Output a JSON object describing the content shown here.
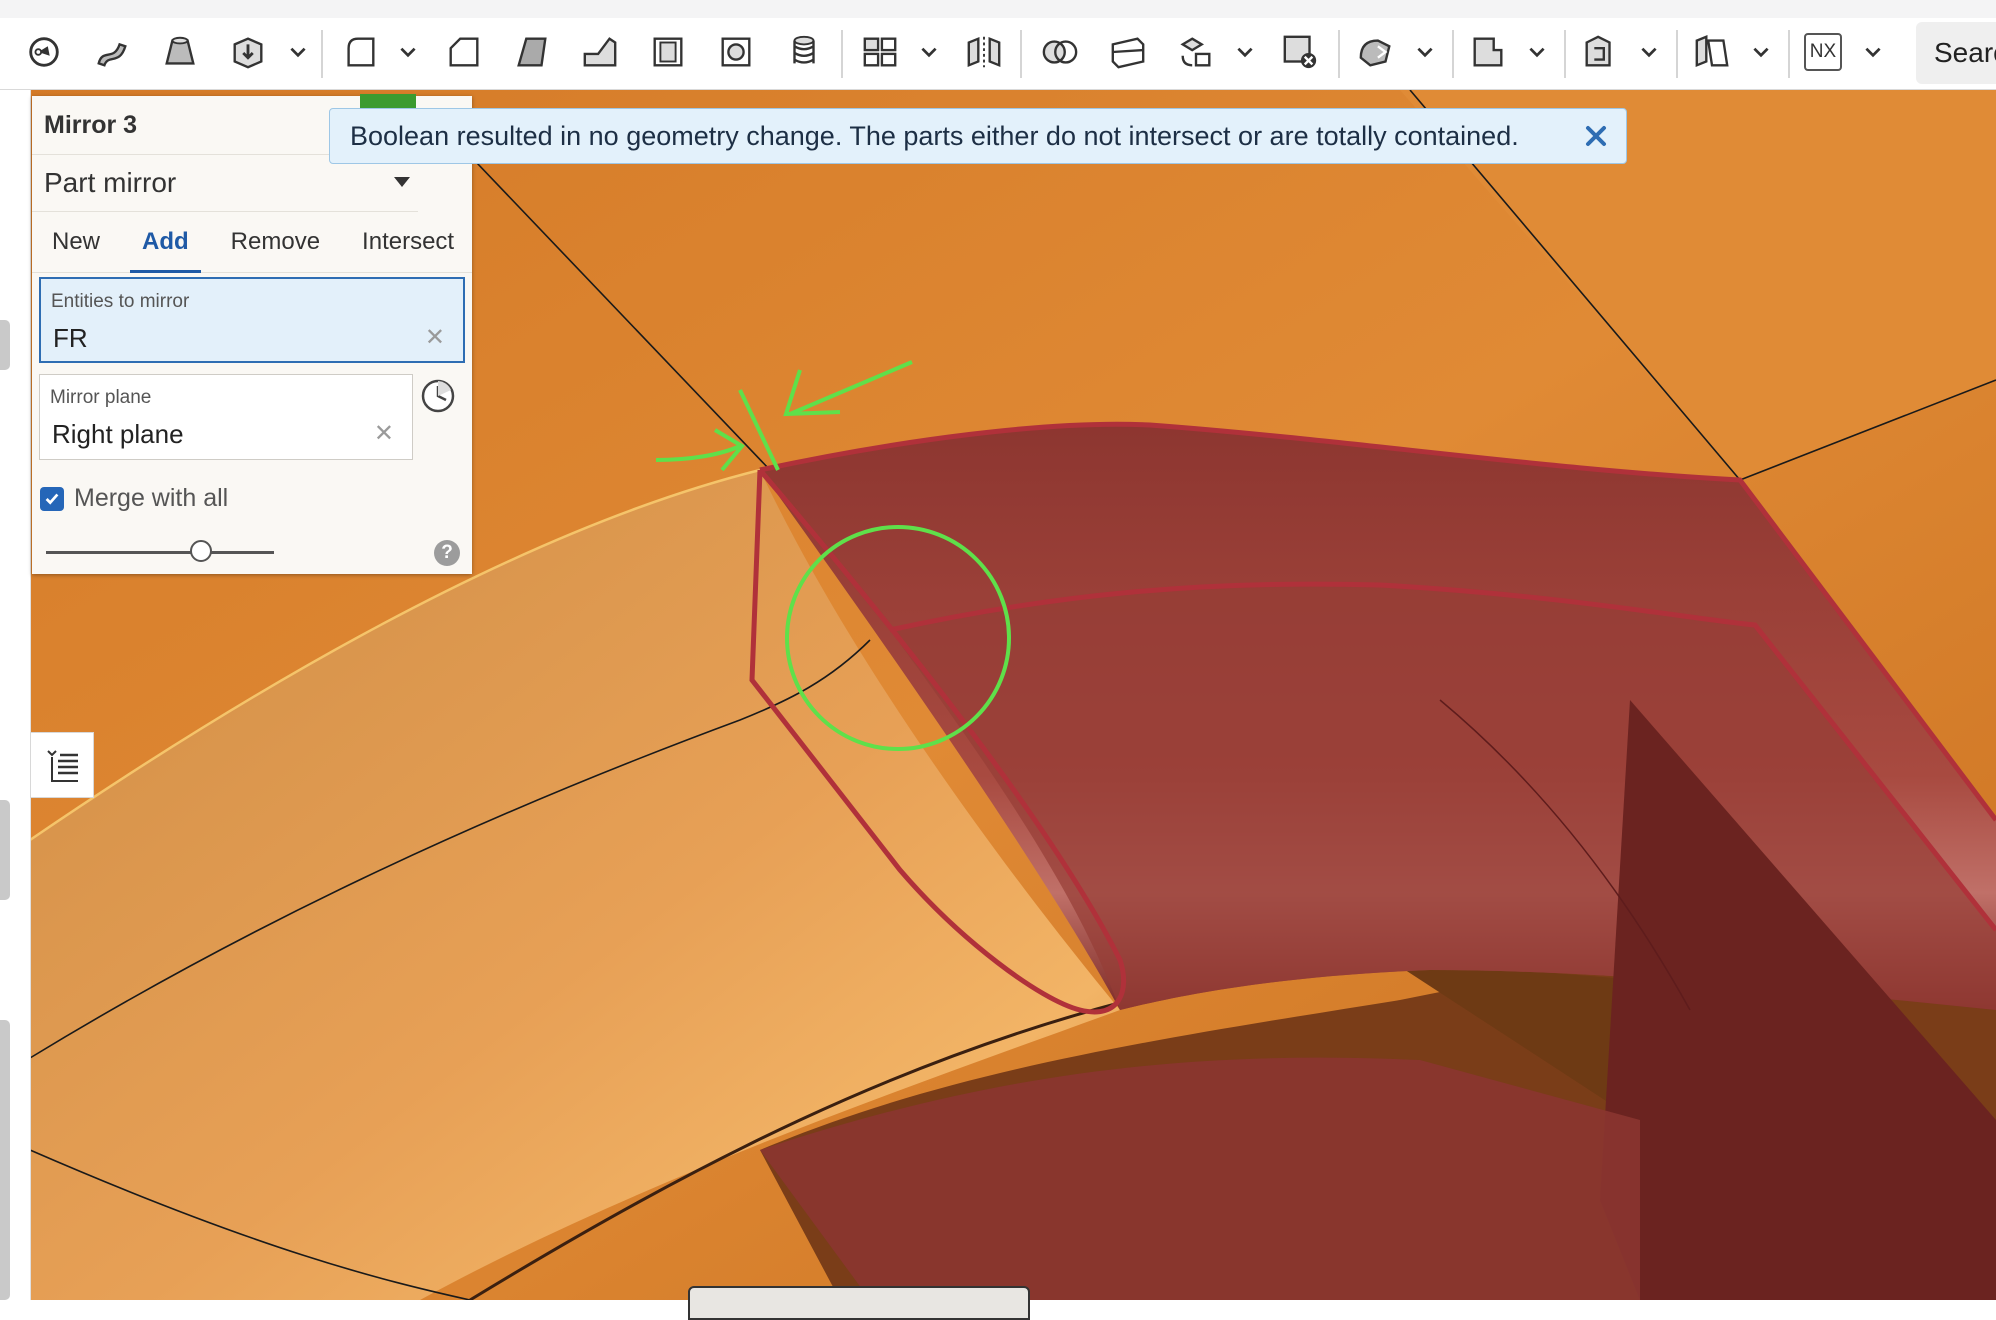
{
  "toolbar": {
    "icons": [
      "sketch-icon",
      "sweep-icon",
      "loft-icon",
      "extrude-menu-icon",
      "fillet-icon",
      "chamfer-icon",
      "draft-icon",
      "rib-icon",
      "shell-icon",
      "hole-icon",
      "thread-icon",
      "pattern-icon",
      "mirror-icon",
      "boolean-icon",
      "split-icon",
      "transform-icon",
      "delete-part-icon",
      "modify-fillet-icon",
      "plane-icon",
      "sheet-metal-icon",
      "flange-icon",
      "nx-icon"
    ],
    "nx_label": "NX",
    "search_label": "Searc"
  },
  "dialog": {
    "title": "Mirror 3",
    "mirror_type": "Part mirror",
    "tabs": [
      "New",
      "Add",
      "Remove",
      "Intersect"
    ],
    "active_tab": "Add",
    "entities_field": {
      "label": "Entities to mirror",
      "value": "FR"
    },
    "plane_field": {
      "label": "Mirror plane",
      "value": "Right plane"
    },
    "merge_label": "Merge with all",
    "merge_checked": true
  },
  "notification": {
    "message": "Boolean resulted in no geometry change. The parts either do not intersect or are totally contained."
  },
  "colors": {
    "accent": "#2566b8",
    "orange_part": "#d8802c",
    "red_part": "#8a3530",
    "annotation": "#5fe04a",
    "notify_bg": "#e3f1fb"
  }
}
